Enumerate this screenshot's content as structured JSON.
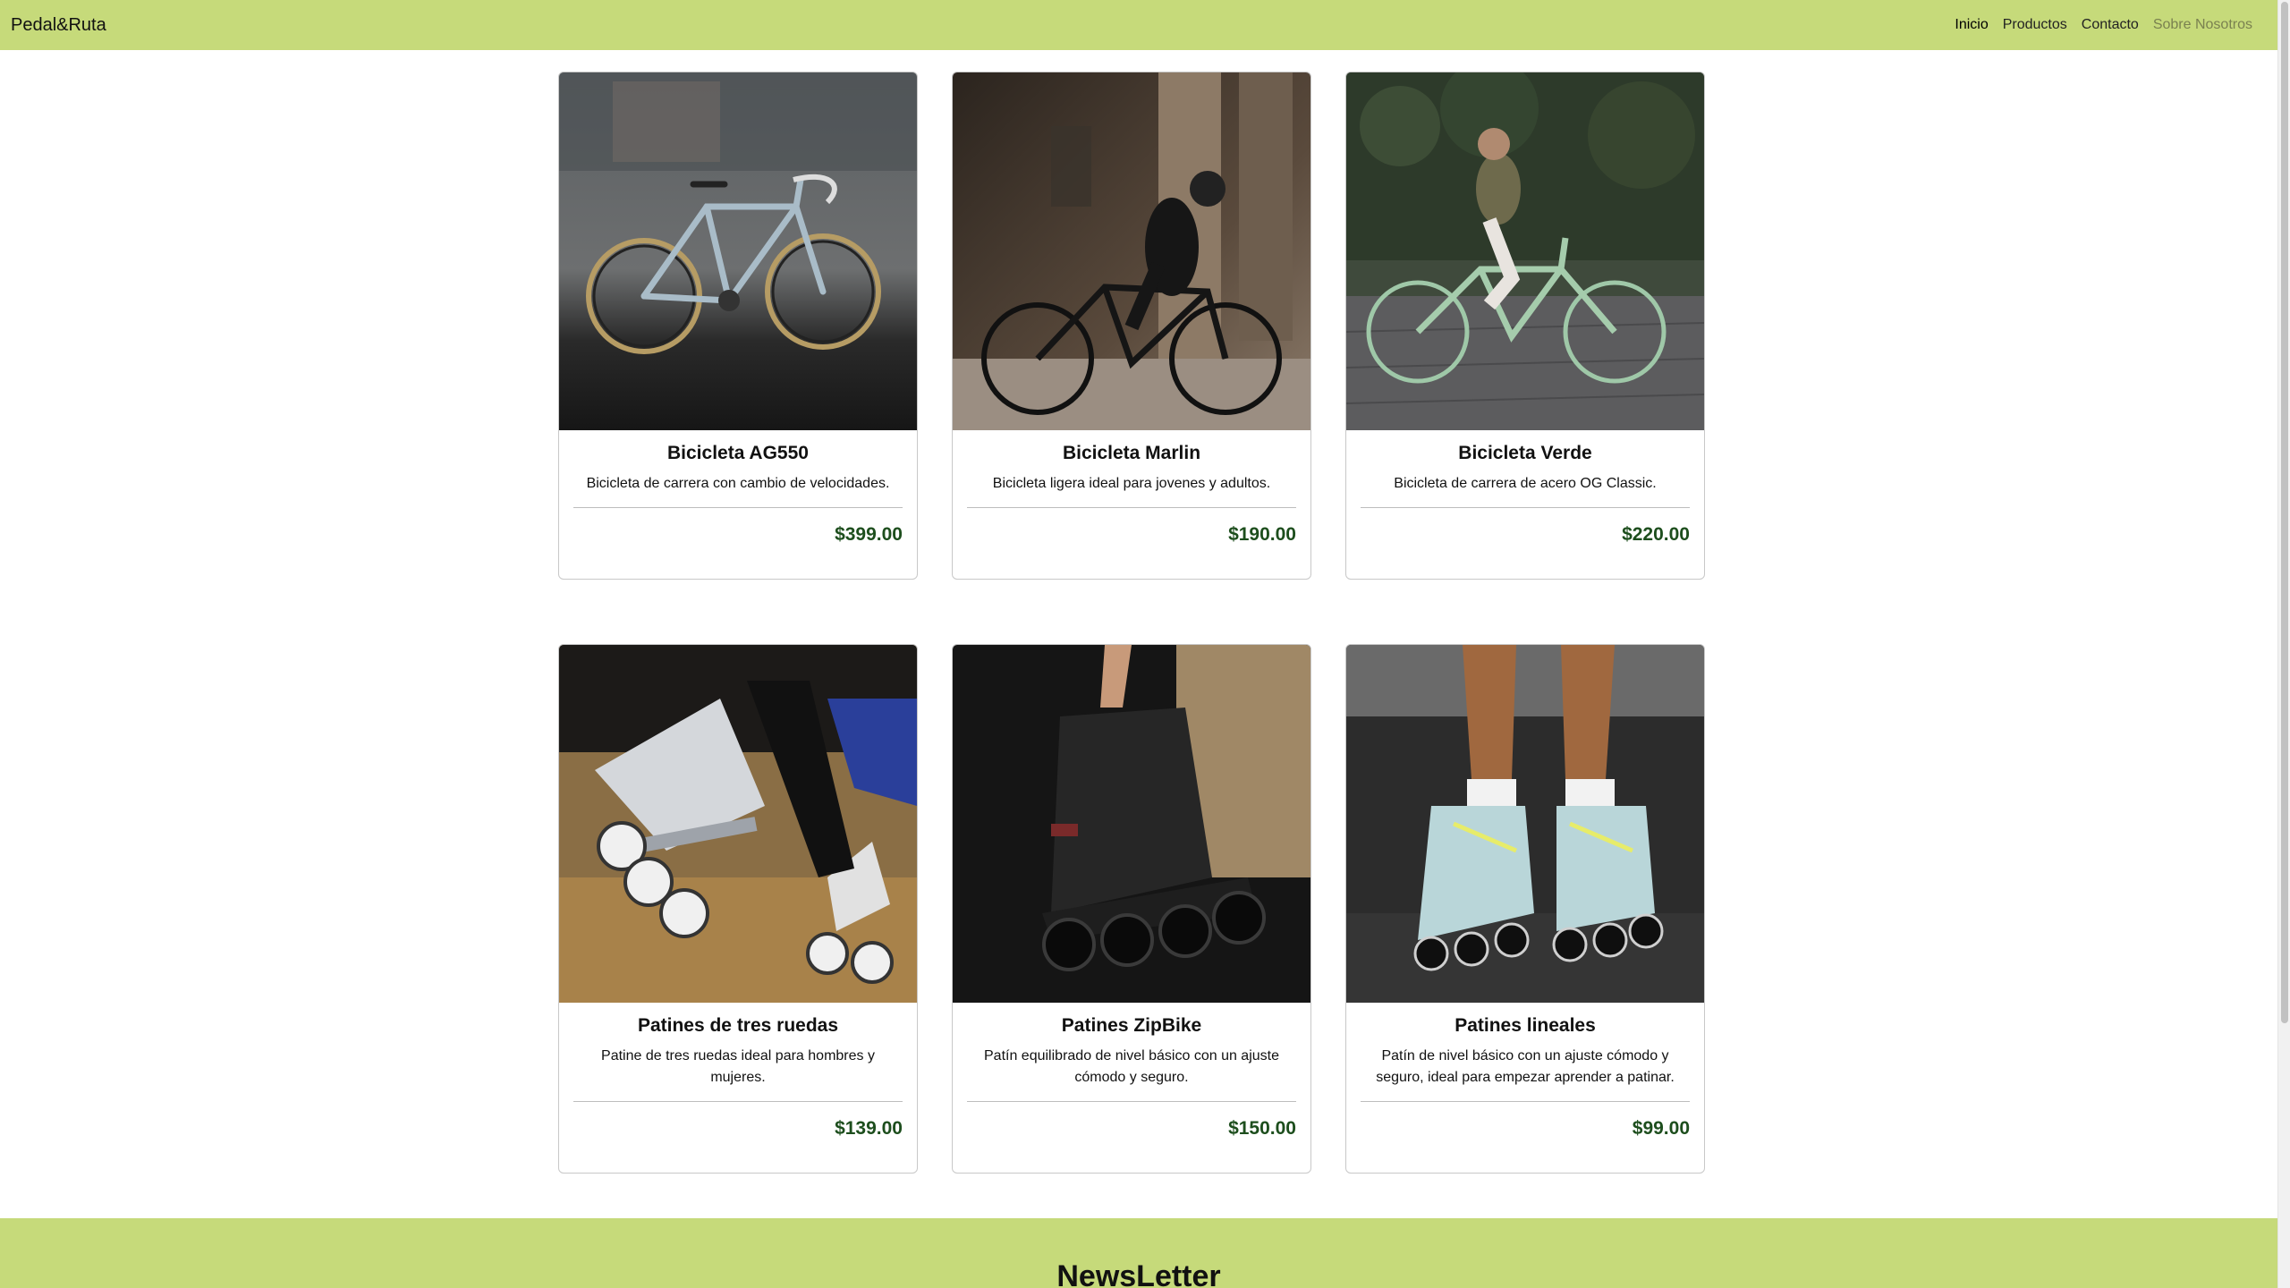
{
  "navbar": {
    "brand": "Pedal&Ruta",
    "links": [
      "Inicio",
      "Productos",
      "Contacto",
      "Sobre Nosotros"
    ]
  },
  "products": [
    {
      "image": "photo-road-bike-grey",
      "title": "Bicicleta AG550",
      "description": "Bicicleta de carrera con cambio de velocidades.",
      "price": "$399.00"
    },
    {
      "image": "photo-cyclist-street",
      "title": "Bicicleta Marlin",
      "description": "Bicicleta ligera ideal para jovenes y adultos.",
      "price": "$190.00"
    },
    {
      "image": "photo-woman-green-bike",
      "title": "Bicicleta Verde",
      "description": "Bicicleta de carrera de acero OG Classic.",
      "price": "$220.00"
    },
    {
      "image": "photo-three-wheel-skates",
      "title": "Patines de tres ruedas",
      "description": "Patine de tres ruedas ideal para hombres y mujeres.",
      "price": "$139.00"
    },
    {
      "image": "photo-black-inline-skate",
      "title": "Patines ZipBike",
      "description": "Patín equilibrado de nivel básico con un ajuste cómodo y seguro.",
      "price": "$150.00"
    },
    {
      "image": "photo-blue-inline-skates",
      "title": "Patines lineales",
      "description": "Patín de nivel básico con un ajuste cómodo y seguro, ideal para empezar aprender a patinar.",
      "price": "$99.00"
    }
  ],
  "newsletter": {
    "title": "NewsLetter"
  },
  "colors": {
    "accent": "#c6da7a",
    "price": "#1d4e1d",
    "nav_muted": "#7a8150"
  }
}
